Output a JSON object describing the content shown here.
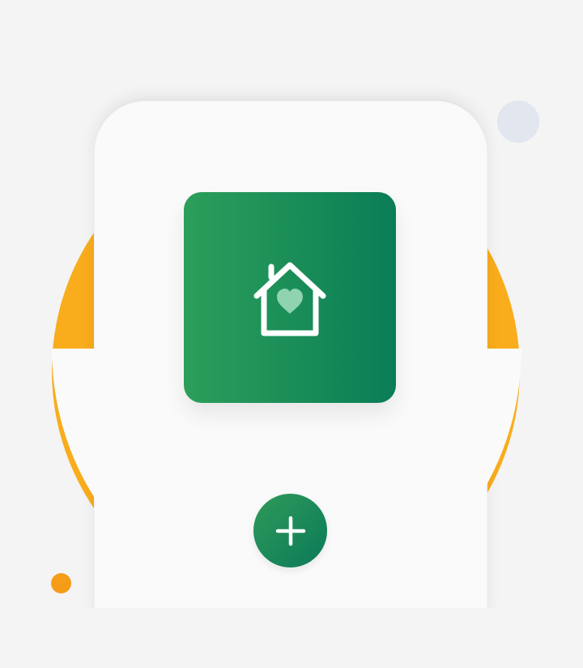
{
  "illustration": {
    "colors": {
      "background": "#f4f4f4",
      "accent_orange": "#f9ad1c",
      "accent_blue": "#e1e6ef",
      "card": "#fafafa",
      "primary_green_start": "#2c9f5a",
      "primary_green_end": "#0a7d57",
      "icon_stroke": "#ffffff",
      "heart": "#8fd3b0"
    },
    "decorations": [
      "orange-disc",
      "blue-dot",
      "orange-dot"
    ],
    "app_tile": {
      "icon": "house-heart-icon"
    },
    "add_button": {
      "icon": "plus-icon"
    }
  }
}
